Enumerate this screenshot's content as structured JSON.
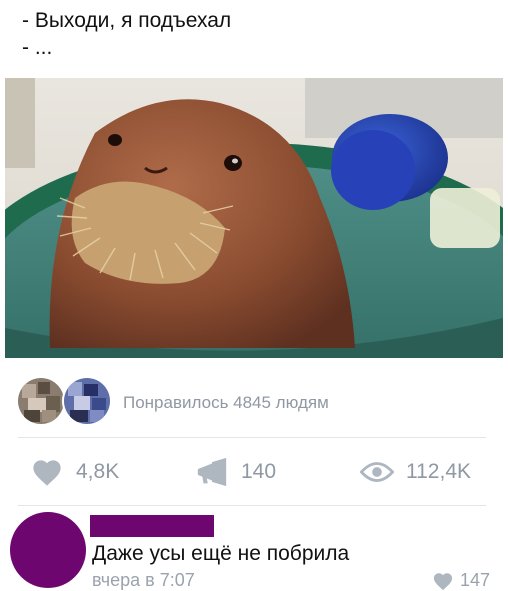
{
  "post": {
    "caption_lines": [
      "- Выходи, я подъехал",
      "- ..."
    ]
  },
  "likes": {
    "text": "Понравилось 4845 людям"
  },
  "stats": {
    "likes": "4,8K",
    "reposts": "140",
    "views": "112,4K"
  },
  "comment": {
    "text": "Даже усы ещё не побрила",
    "time": "вчера в 7:07",
    "likes": "147"
  },
  "colors": {
    "accent_purple": "#6d066f",
    "muted": "#8f98a3"
  },
  "icons": {
    "like": "heart-icon",
    "repost": "megaphone-icon",
    "views": "eye-icon"
  }
}
